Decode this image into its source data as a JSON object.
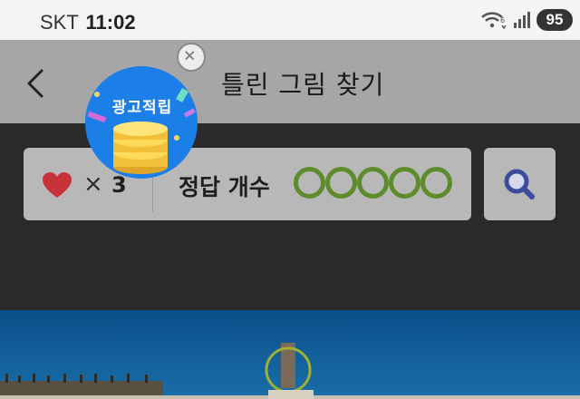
{
  "status_bar": {
    "carrier": "SKT",
    "time": "11:02",
    "wifi_badge": "6",
    "battery": "95"
  },
  "header": {
    "title": "틀린 그림 찾기",
    "back_icon": "chevron-left-icon"
  },
  "ad": {
    "label": "광고적립",
    "close_icon": "close-circle-icon"
  },
  "game": {
    "times_symbol": "×",
    "lives": "3",
    "answer_label": "정답 개수",
    "answers_total": 5,
    "answers_found": 0,
    "search_icon": "magnifier-icon"
  },
  "colors": {
    "heart": "#c8323a",
    "circle": "#5e8c2c",
    "magnifier": "#3e4a9e",
    "ad_blue": "#1c7fe8",
    "sea": "#0b4f8a"
  }
}
